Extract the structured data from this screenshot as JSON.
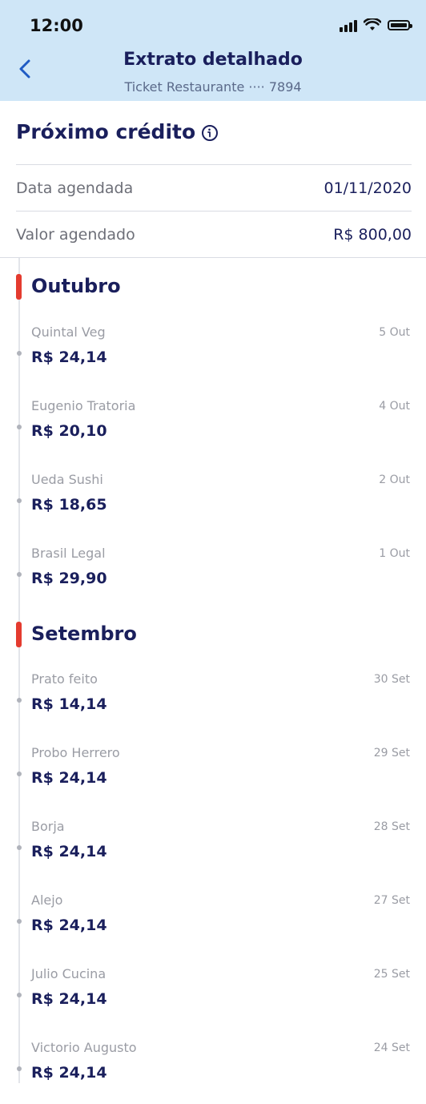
{
  "status_bar": {
    "time": "12:00"
  },
  "header": {
    "title": "Extrato detalhado",
    "subtitle": "Ticket Restaurante ···· 7894"
  },
  "next_credit": {
    "title": "Próximo crédito",
    "rows": [
      {
        "label": "Data agendada",
        "value": "01/11/2020"
      },
      {
        "label": "Valor agendado",
        "value": "R$ 800,00"
      }
    ]
  },
  "months": [
    {
      "name": "Outubro",
      "transactions": [
        {
          "name": "Quintal Veg",
          "date": "5 Out",
          "amount": "R$ 24,14"
        },
        {
          "name": "Eugenio Tratoria",
          "date": "4 Out",
          "amount": "R$ 20,10"
        },
        {
          "name": "Ueda Sushi",
          "date": "2 Out",
          "amount": "R$ 18,65"
        },
        {
          "name": "Brasil Legal",
          "date": "1 Out",
          "amount": "R$ 29,90"
        }
      ]
    },
    {
      "name": "Setembro",
      "transactions": [
        {
          "name": "Prato feito",
          "date": "30 Set",
          "amount": "R$ 14,14"
        },
        {
          "name": "Probo Herrero",
          "date": "29 Set",
          "amount": "R$ 24,14"
        },
        {
          "name": "Borja",
          "date": "28 Set",
          "amount": "R$ 24,14"
        },
        {
          "name": "Alejo",
          "date": "27 Set",
          "amount": "R$ 24,14"
        },
        {
          "name": "Julio Cucina",
          "date": "25 Set",
          "amount": "R$ 24,14"
        },
        {
          "name": "Victorio Augusto",
          "date": "24 Set",
          "amount": "R$ 24,14"
        }
      ]
    }
  ],
  "colors": {
    "header_bg": "#cfe6f7",
    "accent": "#e43b2f",
    "primary": "#1a1f5c"
  }
}
